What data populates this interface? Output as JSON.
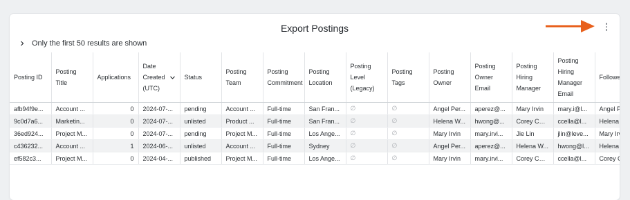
{
  "dialog": {
    "title": "Export Postings",
    "menu_icon": "kebab-menu-icon",
    "notice": "Only the first 50 results are shown",
    "annotation_color": "#e8601c"
  },
  "table": {
    "columns": [
      "Posting ID",
      "Posting Title",
      "Applications",
      "Date Created (UTC)",
      "Status",
      "Posting Team",
      "Posting Commitment",
      "Posting Location",
      "Posting Level (Legacy)",
      "Posting Tags",
      "Posting Owner",
      "Posting Owner Email",
      "Posting Hiring Manager",
      "Posting Hiring Manager Email",
      "Followers"
    ],
    "sorted_column": "Date Created (UTC)",
    "rows": [
      [
        "afb94f9e...",
        "Account ...",
        "0",
        "2024-07-...",
        "pending",
        "Account ...",
        "Full-time",
        "San Fran...",
        "∅",
        "∅",
        "Angel Per...",
        "aperez@...",
        "Mary Irvin",
        "mary.i@l...",
        "Angel Pe"
      ],
      [
        "9c0d7a6...",
        "Marketin...",
        "0",
        "2024-07-...",
        "unlisted",
        "Product ...",
        "Full-time",
        "San Fran...",
        "∅",
        "∅",
        "Helena W...",
        "hwong@...",
        "Corey Cella",
        "ccella@l...",
        "Helena W"
      ],
      [
        "36ed924...",
        "Project M...",
        "0",
        "2024-07-...",
        "pending",
        "Project M...",
        "Full-time",
        "Los Ange...",
        "∅",
        "∅",
        "Mary Irvin",
        "mary.irvi...",
        "Jie Lin",
        "jlin@leve...",
        "Mary Irvi"
      ],
      [
        "c436232...",
        "Account ...",
        "1",
        "2024-06-...",
        "unlisted",
        "Account ...",
        "Full-time",
        "Sydney",
        "∅",
        "∅",
        "Angel Per...",
        "aperez@...",
        "Helena W...",
        "hwong@l...",
        "Helena W"
      ],
      [
        "ef582c3...",
        "Project M...",
        "0",
        "2024-04-...",
        "published",
        "Project M...",
        "Full-time",
        "Los Ange...",
        "∅",
        "∅",
        "Mary Irvin",
        "mary.irvi...",
        "Corey Cella",
        "ccella@l...",
        "Corey Ce"
      ]
    ]
  }
}
